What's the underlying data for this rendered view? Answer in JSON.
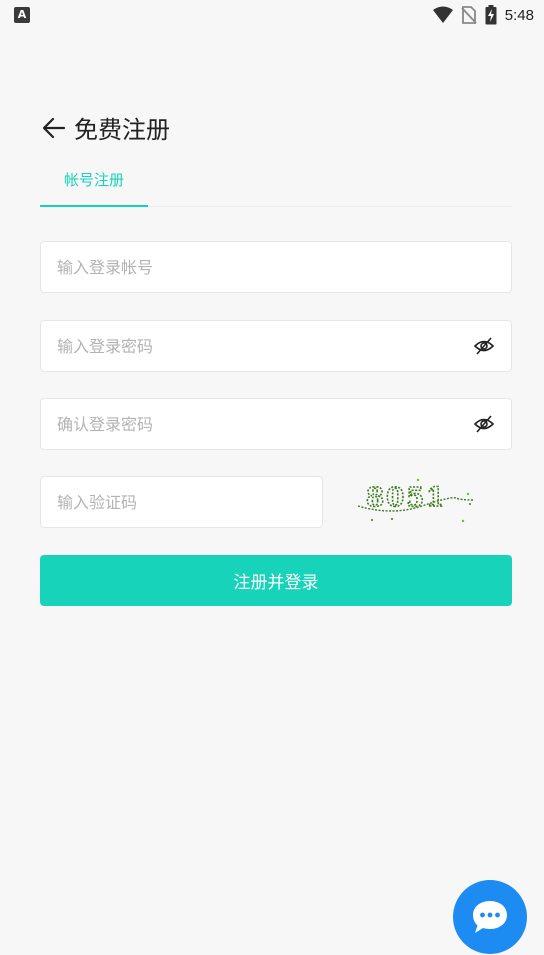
{
  "status_bar": {
    "app_badge": "A",
    "time": "5:48",
    "icons": [
      "wifi-icon",
      "no-sim-icon",
      "battery-charging-icon"
    ]
  },
  "header": {
    "back_icon": "arrow-left-icon",
    "title": "免费注册"
  },
  "tabs": [
    {
      "label": "帐号注册",
      "active": true
    }
  ],
  "form": {
    "account_placeholder": "输入登录帐号",
    "password_placeholder": "输入登录密码",
    "confirm_placeholder": "确认登录密码",
    "captcha_placeholder": "输入验证码",
    "captcha_text": "8051",
    "password_toggle_icon": "eye-off-icon",
    "submit_label": "注册并登录"
  },
  "chat_fab": {
    "icon": "chat-bubble-icon"
  },
  "colors": {
    "accent": "#16d3b9",
    "fab": "#1c8cf3",
    "background": "#f7f7f7",
    "captcha_text": "#3c7a1c"
  }
}
